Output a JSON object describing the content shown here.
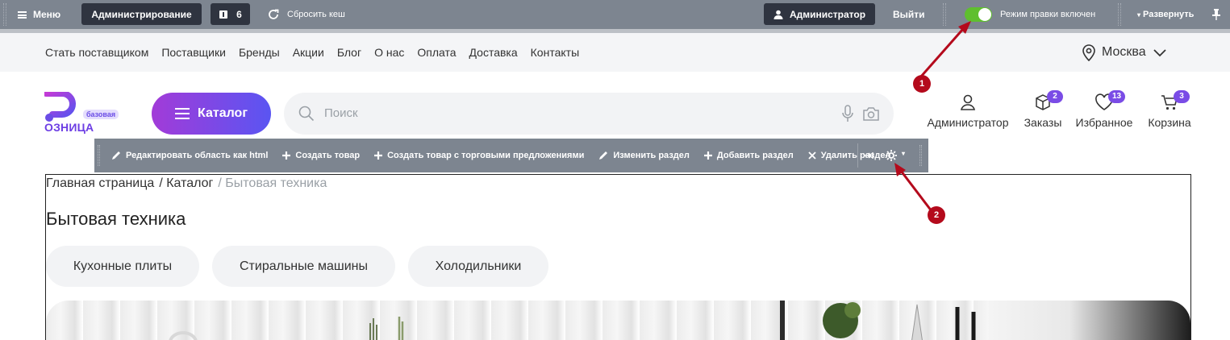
{
  "admin": {
    "menu_label": "Меню",
    "administration_label": "Администрирование",
    "notifications_count": "6",
    "clear_cache_label": "Сбросить кеш",
    "user_label": "Администратор",
    "logout_label": "Выйти",
    "edit_mode_label": "Режим правки включен",
    "expand_label": "Развернуть",
    "toggle_color": "#5fbf2f"
  },
  "top_menu": {
    "links": [
      "Стать поставщиком",
      "Поставщики",
      "Бренды",
      "Акции",
      "Блог",
      "О нас",
      "Оплата",
      "Доставка",
      "Контакты"
    ],
    "city": "Москва"
  },
  "header": {
    "logo_badge": "базовая",
    "logo_text": "ОЗНИЦА",
    "catalog_label": "Каталог",
    "search_placeholder": "Поиск",
    "icons": [
      {
        "label": "Администратор",
        "icon": "user-icon"
      },
      {
        "label": "Заказы",
        "icon": "box-icon",
        "badge": "2"
      },
      {
        "label": "Избранное",
        "icon": "heart-icon",
        "badge": "13"
      },
      {
        "label": "Корзина",
        "icon": "cart-icon",
        "badge": "3"
      }
    ],
    "accent_color": "#7a4ce6"
  },
  "edit_toolbar": {
    "items": [
      {
        "label": "Редактировать область как html",
        "icon": "pencil-icon"
      },
      {
        "label": "Создать товар",
        "icon": "plus-icon"
      },
      {
        "label": "Создать товар с торговыми предложениями",
        "icon": "plus-icon"
      },
      {
        "label": "Изменить раздел",
        "icon": "pencil-icon"
      },
      {
        "label": "Добавить раздел",
        "icon": "plus-icon"
      },
      {
        "label": "Удалить раздел",
        "icon": "close-icon"
      }
    ]
  },
  "breadcrumb": {
    "items": [
      "Главная страница",
      "/ Каталог"
    ],
    "current": "/ Бытовая техника"
  },
  "page": {
    "title": "Бытовая техника",
    "chips": [
      "Кухонные плиты",
      "Стиральные машины",
      "Холодильники"
    ]
  },
  "annotations": {
    "marker_1": "1",
    "marker_2": "2",
    "marker_color": "#b40a1c"
  }
}
